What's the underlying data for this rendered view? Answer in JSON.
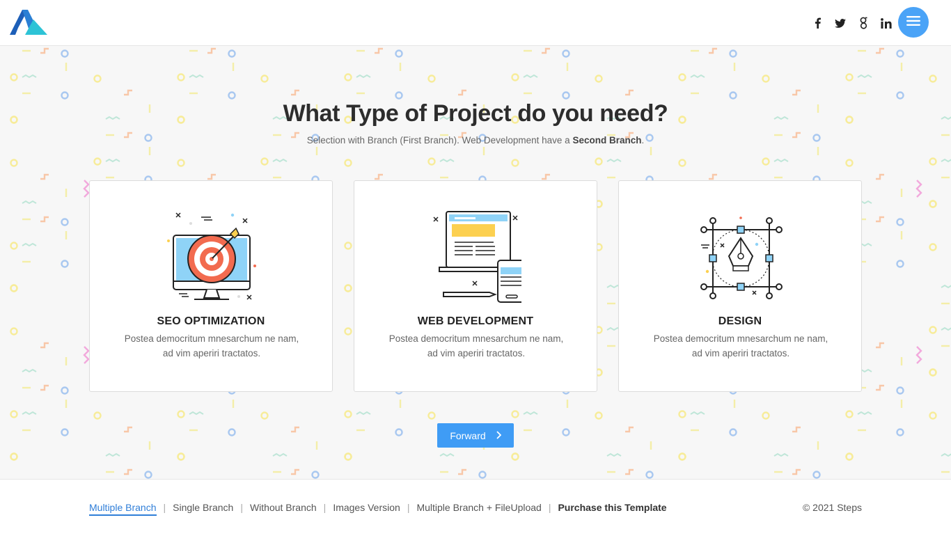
{
  "header": {
    "social": [
      "facebook-icon",
      "twitter-icon",
      "google-plus-icon",
      "linkedin-icon"
    ],
    "menu_icon": "hamburger-menu-icon"
  },
  "main": {
    "title": "What Type of Project do you need?",
    "subtitle_prefix": "Selection with Branch (First Branch). Web Development have a ",
    "subtitle_strong": "Second Branch",
    "subtitle_suffix": ".",
    "cards": [
      {
        "title": "SEO OPTIMIZATION",
        "desc_line1": "Postea democritum mnesarchum ne nam,",
        "desc_line2": "ad vim aperiri tractatos.",
        "icon": "seo-target-monitor-icon"
      },
      {
        "title": "WEB DEVELOPMENT",
        "desc_line1": "Postea democritum mnesarchum ne nam,",
        "desc_line2": "ad vim aperiri tractatos.",
        "icon": "web-development-devices-icon"
      },
      {
        "title": "DESIGN",
        "desc_line1": "Postea democritum mnesarchum ne nam,",
        "desc_line2": "ad vim aperiri tractatos.",
        "icon": "pen-tool-design-icon"
      }
    ],
    "forward_label": "Forward"
  },
  "footer": {
    "links": [
      "Multiple Branch",
      "Single Branch",
      "Without Branch",
      "Images Version",
      "Multiple Branch + FileUpload",
      "Purchase this Template"
    ],
    "copyright": "© 2021 Steps"
  },
  "colors": {
    "accent": "#3f9cf5",
    "logo_dark": "#1d5fb8",
    "logo_light": "#2dc3d6",
    "target_red": "#f26b4f",
    "screen_blue": "#8fd3f7",
    "panel_yellow": "#fcd050"
  }
}
